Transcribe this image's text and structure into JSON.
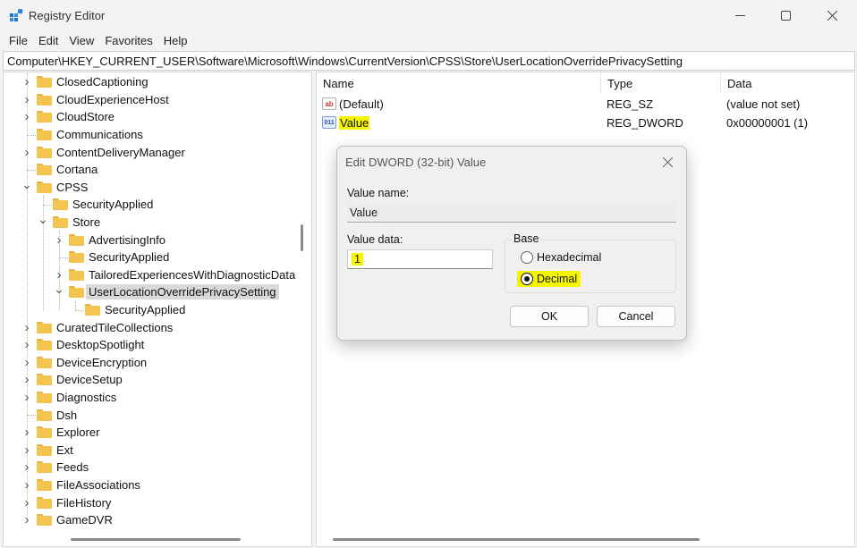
{
  "window": {
    "title": "Registry Editor",
    "icon": "registry-icon"
  },
  "menu": [
    "File",
    "Edit",
    "View",
    "Favorites",
    "Help"
  ],
  "address": "Computer\\HKEY_CURRENT_USER\\Software\\Microsoft\\Windows\\CurrentVersion\\CPSS\\Store\\UserLocationOverridePrivacySetting",
  "tree": {
    "items": [
      {
        "label": "ClosedCaptioning",
        "level": 0,
        "expander": "collapsed"
      },
      {
        "label": "CloudExperienceHost",
        "level": 0,
        "expander": "collapsed"
      },
      {
        "label": "CloudStore",
        "level": 0,
        "expander": "collapsed"
      },
      {
        "label": "Communications",
        "level": 0,
        "expander": "none"
      },
      {
        "label": "ContentDeliveryManager",
        "level": 0,
        "expander": "collapsed"
      },
      {
        "label": "Cortana",
        "level": 0,
        "expander": "none"
      },
      {
        "label": "CPSS",
        "level": 0,
        "expander": "expanded"
      },
      {
        "label": "SecurityApplied",
        "level": 1,
        "expander": "none"
      },
      {
        "label": "Store",
        "level": 1,
        "expander": "expanded"
      },
      {
        "label": "AdvertisingInfo",
        "level": 2,
        "expander": "collapsed"
      },
      {
        "label": "SecurityApplied",
        "level": 2,
        "expander": "none"
      },
      {
        "label": "TailoredExperiencesWithDiagnosticData",
        "level": 2,
        "expander": "collapsed"
      },
      {
        "label": "UserLocationOverridePrivacySetting",
        "level": 2,
        "expander": "expanded",
        "selected": true
      },
      {
        "label": "SecurityApplied",
        "level": 3,
        "expander": "none"
      },
      {
        "label": "CuratedTileCollections",
        "level": 0,
        "expander": "collapsed"
      },
      {
        "label": "DesktopSpotlight",
        "level": 0,
        "expander": "collapsed"
      },
      {
        "label": "DeviceEncryption",
        "level": 0,
        "expander": "collapsed"
      },
      {
        "label": "DeviceSetup",
        "level": 0,
        "expander": "collapsed"
      },
      {
        "label": "Diagnostics",
        "level": 0,
        "expander": "collapsed"
      },
      {
        "label": "Dsh",
        "level": 0,
        "expander": "none"
      },
      {
        "label": "Explorer",
        "level": 0,
        "expander": "collapsed"
      },
      {
        "label": "Ext",
        "level": 0,
        "expander": "collapsed"
      },
      {
        "label": "Feeds",
        "level": 0,
        "expander": "collapsed"
      },
      {
        "label": "FileAssociations",
        "level": 0,
        "expander": "collapsed"
      },
      {
        "label": "FileHistory",
        "level": 0,
        "expander": "collapsed"
      },
      {
        "label": "GameDVR",
        "level": 0,
        "expander": "collapsed"
      }
    ]
  },
  "values": {
    "columns": {
      "name": "Name",
      "type": "Type",
      "data": "Data"
    },
    "rows": [
      {
        "name": "(Default)",
        "type": "REG_SZ",
        "data": "(value not set)",
        "icon": "string-value-icon"
      },
      {
        "name": "Value",
        "type": "REG_DWORD",
        "data": "0x00000001 (1)",
        "icon": "dword-value-icon",
        "highlighted": true
      }
    ]
  },
  "dialog": {
    "title": "Edit DWORD (32-bit) Value",
    "value_name_label": "Value name:",
    "value_name": "Value",
    "value_data_label": "Value data:",
    "value_data": "1",
    "base_label": "Base",
    "base_options": [
      "Hexadecimal",
      "Decimal"
    ],
    "base_selected": "Decimal",
    "ok_label": "OK",
    "cancel_label": "Cancel"
  },
  "colors": {
    "highlight": "#f5f500",
    "folder": "#f4c451",
    "selection": "#d9d9d9"
  }
}
